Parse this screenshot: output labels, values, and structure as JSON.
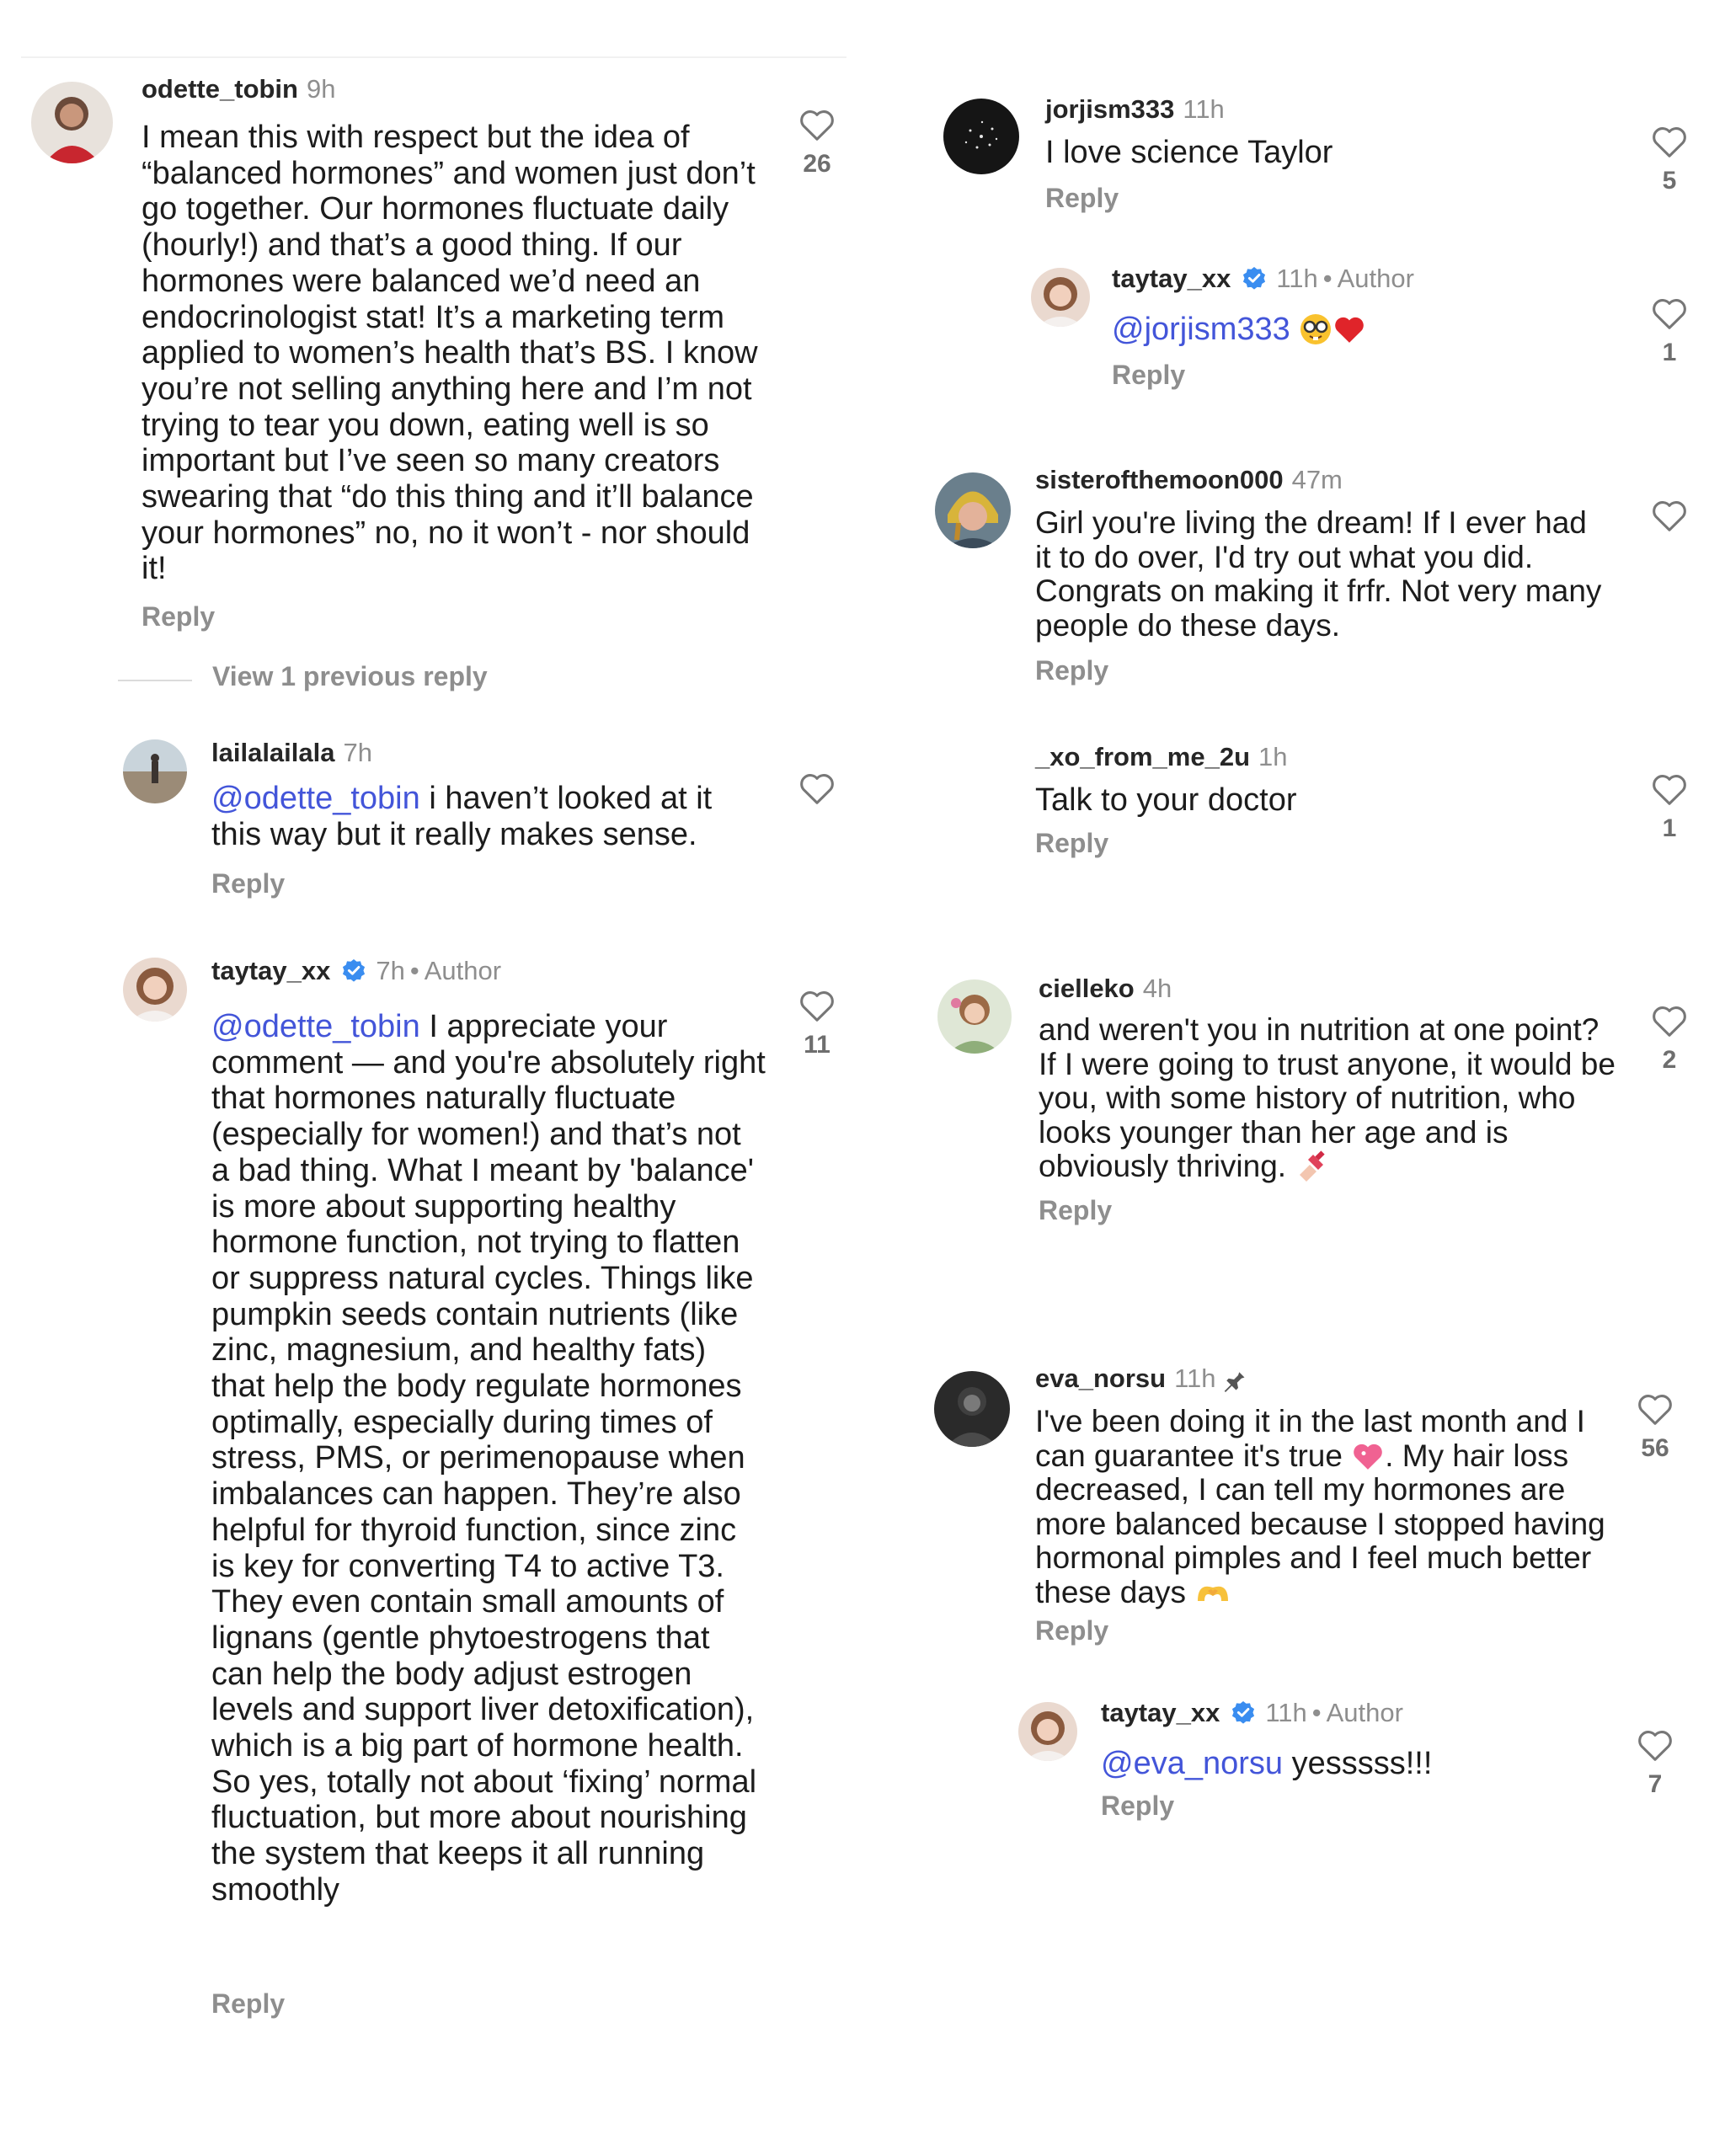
{
  "comments": [
    {
      "user": "odette_tobin",
      "time": "9h",
      "text": "I mean this with respect but the idea of “balanced hormones” and women just don’t go together. Our hormones fluctuate daily (hourly!) and that’s a good thing. If our hormones were balanced we’d need an endocrinologist stat! It’s a marketing term applied to women’s health that’s BS. I know you’re not selling anything here and I’m not trying to tear you down, eating well is so important but I’ve seen so many creators swearing that “do this thing and it’ll balance your hormones” no, no it won’t - nor should it!",
      "reply": "Reply",
      "likes": "26"
    },
    {
      "view_previous": "View 1 previous reply"
    },
    {
      "user": "lailalailala",
      "time": "7h",
      "mention": "@odette_tobin",
      "text": " i haven’t looked at it this way but it really makes sense.",
      "reply": "Reply"
    },
    {
      "user": "taytay_xx",
      "time": "7h",
      "dot": "•",
      "author": "Author",
      "mention": "@odette_tobin",
      "text": " I appreciate your comment — and you're absolutely right that hormones naturally fluctuate (especially for women!) and that’s not a bad thing. What I meant by 'balance' is more about supporting healthy hormone function, not trying to flatten or suppress natural cycles. Things like pumpkin seeds contain nutrients (like zinc, magnesium, and healthy fats) that help the body regulate hormones optimally, especially during times of stress, PMS, or perimenopause when imbalances can happen. They’re also helpful for thyroid function, since zinc is key for converting T4 to active T3. They even contain small amounts of lignans (gentle phytoestrogens that can help the body adjust estrogen levels and support liver detoxification), which is a big part of hormone health. So yes, totally not about ‘fixing’ normal fluctuation, but more about nourishing the system that keeps it all running smoothly",
      "reply": "Reply",
      "likes": "11"
    },
    {
      "user": "jorjism333",
      "time": "11h",
      "text": "I love science Taylor",
      "reply": "Reply",
      "likes": "5"
    },
    {
      "user": "taytay_xx",
      "time": "11h",
      "dot": "•",
      "author": "Author",
      "mention": "@jorjism333",
      "text": " ",
      "reply": "Reply",
      "likes": "1"
    },
    {
      "user": "sisterofthemoon000",
      "time": "47m",
      "text": "Girl you're living the dream! If I ever had it to do over, I'd try out what you did. Congrats on making it frfr. Not very many people do these days.",
      "reply": "Reply"
    },
    {
      "user": "_xo_from_me_2u",
      "time": "1h",
      "text": "Talk to your doctor",
      "reply": "Reply",
      "likes": "1"
    },
    {
      "user": "cielleko",
      "time": "4h",
      "text": "and weren't you in nutrition at one point? If I were going to trust anyone, it would be you, with some history of nutrition, who looks younger than her age and is obviously thriving. ",
      "reply": "Reply",
      "likes": "2"
    },
    {
      "user": "eva_norsu",
      "time": "11h",
      "text1": "I've been doing it in the last month and I can guarantee it's true ",
      "text2": ". My hair loss decreased, I can tell my hormones are more balanced because I stopped having hormonal pimples and I feel much better these days ",
      "reply": "Reply",
      "likes": "56"
    },
    {
      "user": "taytay_xx",
      "time": "11h",
      "dot": "•",
      "author": "Author",
      "mention": "@eva_norsu",
      "text": " yesssss!!!",
      "reply": "Reply",
      "likes": "7"
    }
  ],
  "colors": {
    "mention": "#4355d9",
    "verified": "#3a8df0",
    "secondary": "#8e8e8e"
  }
}
